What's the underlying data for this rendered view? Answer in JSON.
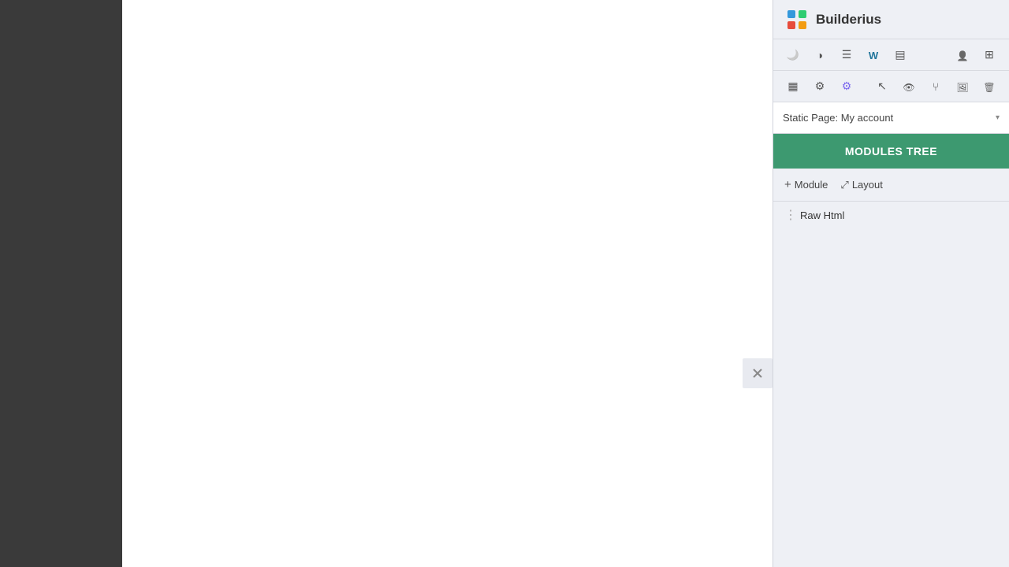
{
  "app": {
    "title": "Builderius"
  },
  "toolbar_row1": {
    "btn1_title": "Dark mode",
    "btn2_title": "Contrast",
    "btn3_title": "List view",
    "btn4_title": "WordPress",
    "btn5_title": "Page view",
    "btn6_title": "User",
    "btn7_title": "Layers"
  },
  "toolbar_row2": {
    "btn1_title": "Layout grid",
    "btn2_title": "Settings",
    "btn3_title": "Settings alt",
    "btn4_title": "Cursor",
    "btn5_title": "Preview",
    "btn6_title": "Branch",
    "btn7_title": "Image",
    "btn8_title": "Delete"
  },
  "page_selector": {
    "label": "Static Page: My account",
    "arrow": "▾"
  },
  "modules_tree": {
    "title": "MODULES TREE"
  },
  "add_buttons": {
    "module_label": "Module",
    "layout_label": "Layout"
  },
  "tree_items": [
    {
      "label": "Raw Html"
    }
  ],
  "close_button": {
    "label": "×"
  }
}
